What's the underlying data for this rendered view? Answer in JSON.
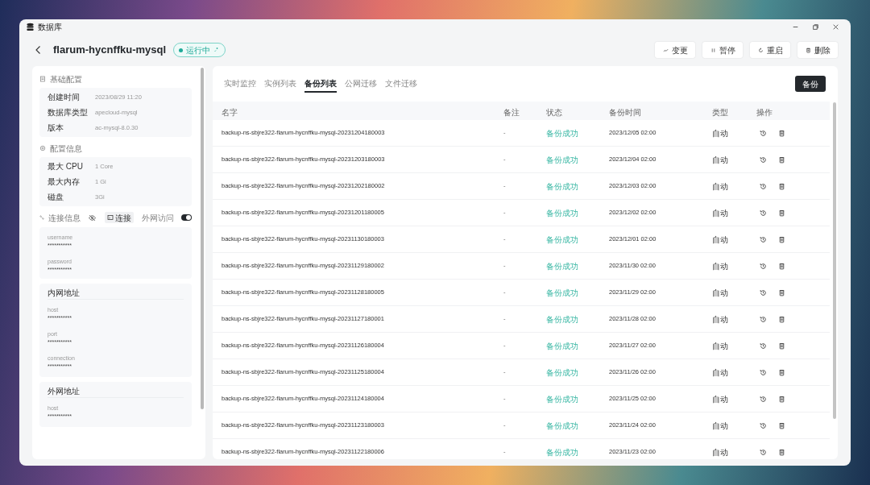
{
  "window": {
    "title": "数据库"
  },
  "header": {
    "name": "flarum-hycnffku-mysql",
    "status": "运行中",
    "actions": [
      {
        "label": "变更",
        "kind": "change"
      },
      {
        "label": "暂停",
        "kind": "pause"
      },
      {
        "label": "重启",
        "kind": "restart"
      },
      {
        "label": "删除",
        "kind": "delete"
      }
    ]
  },
  "sidebar": {
    "basic": {
      "title": "基础配置",
      "rows": [
        {
          "label": "创建时间",
          "value": "2023/08/29 11:20"
        },
        {
          "label": "数据库类型",
          "value": "apecloud-mysql"
        },
        {
          "label": "版本",
          "value": "ac-mysql-8.0.30"
        }
      ]
    },
    "config": {
      "title": "配置信息",
      "rows": [
        {
          "label": "最大 CPU",
          "value": "1 Core"
        },
        {
          "label": "最大内存",
          "value": "1 Gi"
        },
        {
          "label": "磁盘",
          "value": "3Gi"
        }
      ]
    },
    "connection": {
      "title": "连接信息",
      "connect_label": "连接",
      "external_label": "外网访问",
      "external_on": true,
      "credentials": [
        {
          "label": "username",
          "value": "***********"
        },
        {
          "label": "password",
          "value": "***********"
        }
      ],
      "groups": [
        {
          "title": "内网地址",
          "items": [
            {
              "label": "host",
              "value": "***********"
            },
            {
              "label": "port",
              "value": "***********"
            },
            {
              "label": "connection",
              "value": "***********"
            }
          ]
        },
        {
          "title": "外网地址",
          "items": [
            {
              "label": "host",
              "value": "***********"
            }
          ]
        }
      ]
    }
  },
  "tabs": [
    {
      "label": "实时监控",
      "selected": false
    },
    {
      "label": "实例列表",
      "selected": false
    },
    {
      "label": "备份列表",
      "selected": true
    },
    {
      "label": "公网迁移",
      "selected": false
    },
    {
      "label": "文件迁移",
      "selected": false
    }
  ],
  "backup_button": "备份",
  "table": {
    "columns": [
      "名字",
      "备注",
      "状态",
      "备份时间",
      "类型",
      "操作"
    ],
    "rows": [
      {
        "name": "backup-ns-sbjre322-flarum-hycnffku-mysql-20231204180003",
        "note": "-",
        "status": "备份成功",
        "time": "2023/12/05 02:00",
        "type": "自动"
      },
      {
        "name": "backup-ns-sbjre322-flarum-hycnffku-mysql-20231203180003",
        "note": "-",
        "status": "备份成功",
        "time": "2023/12/04 02:00",
        "type": "自动"
      },
      {
        "name": "backup-ns-sbjre322-flarum-hycnffku-mysql-20231202180002",
        "note": "-",
        "status": "备份成功",
        "time": "2023/12/03 02:00",
        "type": "自动"
      },
      {
        "name": "backup-ns-sbjre322-flarum-hycnffku-mysql-20231201180005",
        "note": "-",
        "status": "备份成功",
        "time": "2023/12/02 02:00",
        "type": "自动"
      },
      {
        "name": "backup-ns-sbjre322-flarum-hycnffku-mysql-20231130180003",
        "note": "-",
        "status": "备份成功",
        "time": "2023/12/01 02:00",
        "type": "自动"
      },
      {
        "name": "backup-ns-sbjre322-flarum-hycnffku-mysql-20231129180002",
        "note": "-",
        "status": "备份成功",
        "time": "2023/11/30 02:00",
        "type": "自动"
      },
      {
        "name": "backup-ns-sbjre322-flarum-hycnffku-mysql-20231128180005",
        "note": "-",
        "status": "备份成功",
        "time": "2023/11/29 02:00",
        "type": "自动"
      },
      {
        "name": "backup-ns-sbjre322-flarum-hycnffku-mysql-20231127180001",
        "note": "-",
        "status": "备份成功",
        "time": "2023/11/28 02:00",
        "type": "自动"
      },
      {
        "name": "backup-ns-sbjre322-flarum-hycnffku-mysql-20231126180004",
        "note": "-",
        "status": "备份成功",
        "time": "2023/11/27 02:00",
        "type": "自动"
      },
      {
        "name": "backup-ns-sbjre322-flarum-hycnffku-mysql-20231125180004",
        "note": "-",
        "status": "备份成功",
        "time": "2023/11/26 02:00",
        "type": "自动"
      },
      {
        "name": "backup-ns-sbjre322-flarum-hycnffku-mysql-20231124180004",
        "note": "-",
        "status": "备份成功",
        "time": "2023/11/25 02:00",
        "type": "自动"
      },
      {
        "name": "backup-ns-sbjre322-flarum-hycnffku-mysql-20231123180003",
        "note": "-",
        "status": "备份成功",
        "time": "2023/11/24 02:00",
        "type": "自动"
      },
      {
        "name": "backup-ns-sbjre322-flarum-hycnffku-mysql-20231122180006",
        "note": "-",
        "status": "备份成功",
        "time": "2023/11/23 02:00",
        "type": "自动"
      }
    ]
  }
}
